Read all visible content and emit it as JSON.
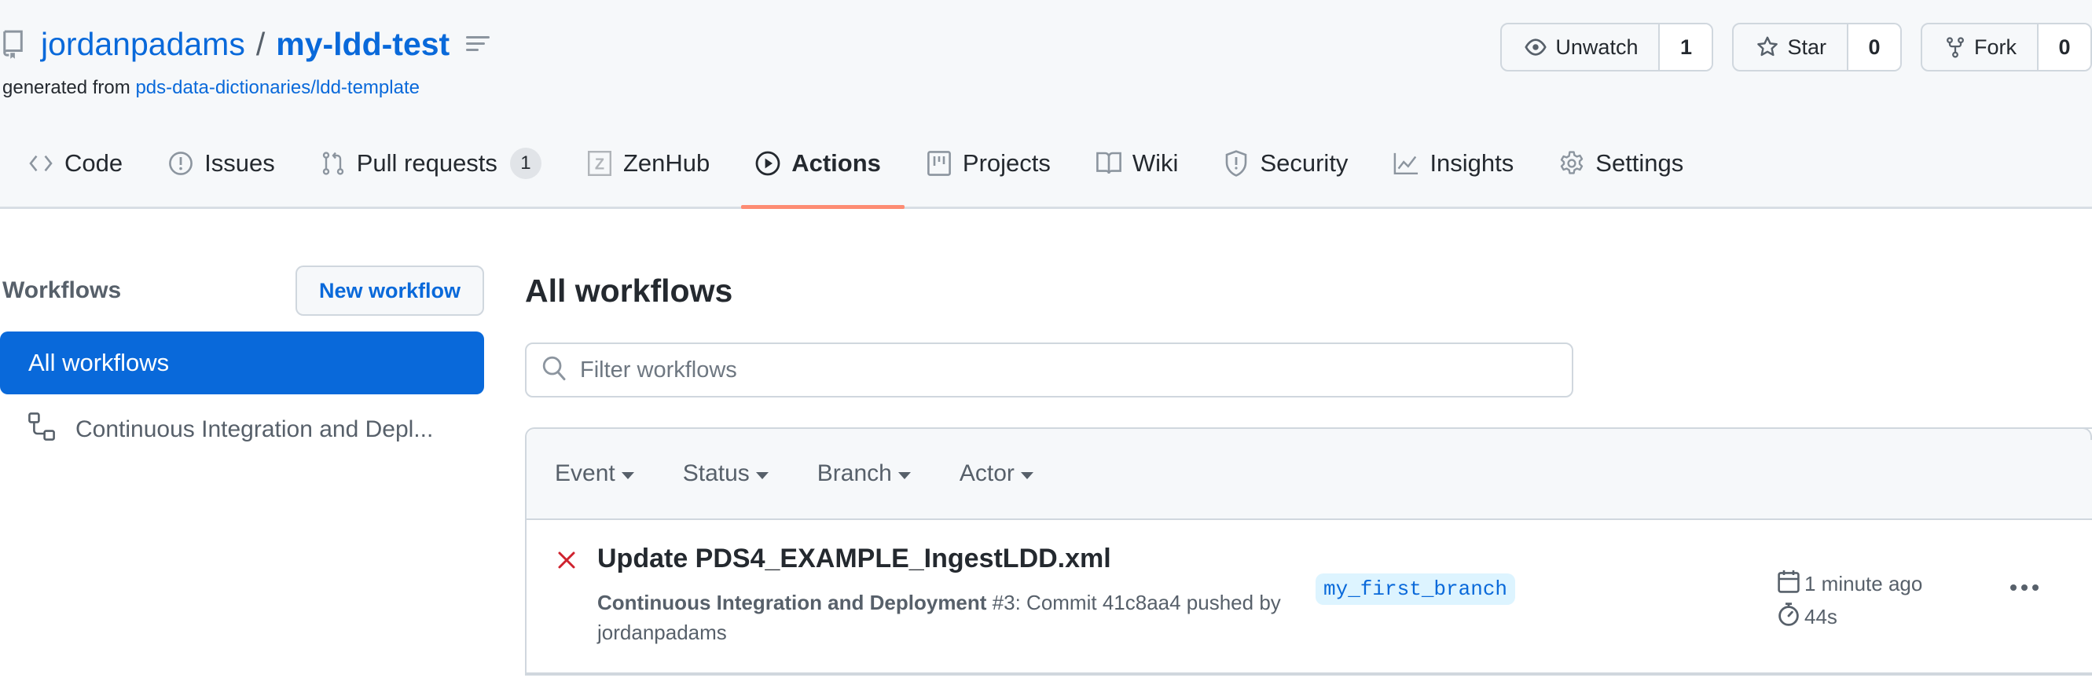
{
  "repo": {
    "owner": "jordanpadams",
    "separator": "/",
    "name": "my-ldd-test",
    "generated_from_label": "generated from",
    "template_link": "pds-data-dictionaries/ldd-template"
  },
  "repo_actions": [
    {
      "label": "Unwatch",
      "count": "1",
      "icon": "eye-icon"
    },
    {
      "label": "Star",
      "count": "0",
      "icon": "star-icon"
    },
    {
      "label": "Fork",
      "count": "0",
      "icon": "repo-forked-icon"
    }
  ],
  "nav": {
    "tabs": [
      {
        "label": "Code",
        "icon": "code-icon"
      },
      {
        "label": "Issues",
        "icon": "issue-opened-icon"
      },
      {
        "label": "Pull requests",
        "icon": "git-pull-request-icon",
        "badge": "1"
      },
      {
        "label": "ZenHub",
        "icon": "zenhub-icon"
      },
      {
        "label": "Actions",
        "icon": "play-icon",
        "active": true
      },
      {
        "label": "Projects",
        "icon": "project-icon"
      },
      {
        "label": "Wiki",
        "icon": "book-icon"
      },
      {
        "label": "Security",
        "icon": "shield-icon"
      },
      {
        "label": "Insights",
        "icon": "graph-icon"
      },
      {
        "label": "Settings",
        "icon": "gear-icon"
      }
    ],
    "active_color": "#fd8c73"
  },
  "sidebar": {
    "title": "Workflows",
    "new_workflow_label": "New workflow",
    "items": [
      {
        "label": "All workflows",
        "active": true
      },
      {
        "label": "Continuous Integration and Depl...",
        "icon": "workflow-icon"
      }
    ]
  },
  "main": {
    "title": "All workflows",
    "filter_placeholder": "Filter workflows",
    "filter_value": "",
    "filters": [
      "Event",
      "Status",
      "Branch",
      "Actor"
    ],
    "runs": [
      {
        "status": "failure",
        "status_color": "#cf222e",
        "title": "Update PDS4_EXAMPLE_IngestLDD.xml",
        "workflow_name": "Continuous Integration and Deployment",
        "run_number": "#3",
        "description": ": Commit 41c8aa4 pushed by jordanpadams",
        "branch": "my_first_branch",
        "time_ago": "1 minute ago",
        "duration": "44s"
      }
    ]
  },
  "colors": {
    "accent": "#0969da",
    "header_bg": "#f6f8fa",
    "failure": "#cf222e"
  }
}
